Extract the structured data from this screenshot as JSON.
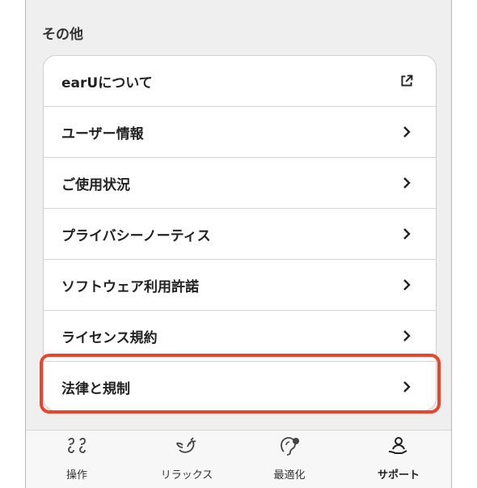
{
  "section": {
    "title": "その他"
  },
  "menu": [
    {
      "label": "earUについて",
      "icon": "external-link-icon"
    },
    {
      "label": "ユーザー情報",
      "icon": "chevron-right-icon"
    },
    {
      "label": "ご使用状況",
      "icon": "chevron-right-icon"
    },
    {
      "label": "プライバシーノーティス",
      "icon": "chevron-right-icon"
    },
    {
      "label": "ソフトウェア利用許諾",
      "icon": "chevron-right-icon"
    },
    {
      "label": "ライセンス規約",
      "icon": "chevron-right-icon"
    },
    {
      "label": "法律と規制",
      "icon": "chevron-right-icon",
      "highlighted": true
    }
  ],
  "highlight_color": "#e8452d",
  "tabs": [
    {
      "label": "操作",
      "icon": "controls-icon"
    },
    {
      "label": "リラックス",
      "icon": "relax-bird-icon"
    },
    {
      "label": "最適化",
      "icon": "ear-optimize-icon"
    },
    {
      "label": "サポート",
      "icon": "support-person-icon",
      "active": true
    }
  ]
}
